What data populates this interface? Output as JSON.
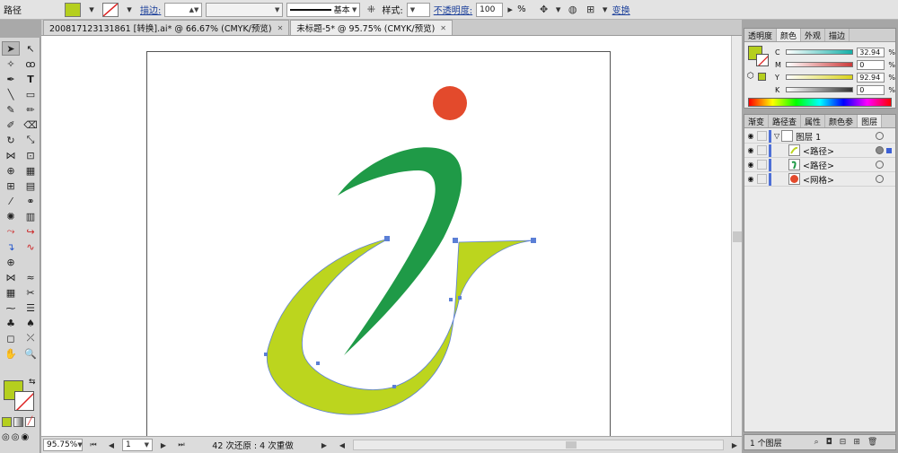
{
  "control_bar": {
    "object_type": "路径",
    "fill_color": "#b5cf1e",
    "stroke_label": "描边:",
    "stroke_weight": "",
    "profile_value": "",
    "brush_label": "基本",
    "style_label": "样式:",
    "opacity_label": "不透明度:",
    "opacity_value": "100",
    "opacity_unit": "%",
    "transform_link": "变换"
  },
  "tabs": [
    {
      "label": "200817123131861 [转换].ai* @ 66.67% (CMYK/预览)"
    },
    {
      "label": "未标题-5* @ 95.75% (CMYK/预览)"
    }
  ],
  "artwork": {
    "dot_color": "#e34a2c",
    "green_color": "#1f9a47",
    "yellow_color": "#bcd51e",
    "anchor_color": "#5b7fd6"
  },
  "status_bar": {
    "zoom": "95.75%",
    "artboard_num": "1",
    "message": "42 次还原 : 4 次重做"
  },
  "color_panel": {
    "tabs": [
      "透明度",
      "颜色",
      "外观",
      "描边"
    ],
    "fill_color": "#b5cf1e",
    "channels": [
      {
        "label": "C",
        "value": "32.94",
        "color": "#14b0a8"
      },
      {
        "label": "M",
        "value": "0",
        "color": "#cc3a3a"
      },
      {
        "label": "Y",
        "value": "92.94",
        "color": "#d9d31a"
      },
      {
        "label": "K",
        "value": "0",
        "color": "#333333"
      }
    ],
    "unit": "%"
  },
  "layers_panel": {
    "tabs": [
      "渐变",
      "路径查",
      "属性",
      "颜色参",
      "图层"
    ],
    "layer": {
      "name": "图层 1"
    },
    "items": [
      {
        "name": "<路径>",
        "thumb_color": "#bcd51e"
      },
      {
        "name": "<路径>",
        "thumb_color": "#1f9a47"
      },
      {
        "name": "<网格>",
        "thumb_color": "#e34a2c"
      }
    ],
    "footer": "1 个图层"
  },
  "tools": {
    "fill_color": "#b5cf1e"
  }
}
